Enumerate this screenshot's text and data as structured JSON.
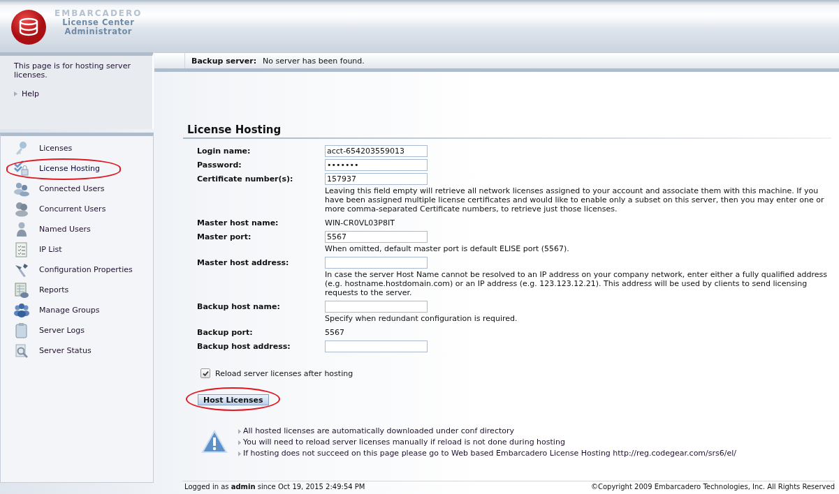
{
  "header": {
    "brand": "EMBARCADERO",
    "title_lines": [
      "License Center",
      "Administrator"
    ]
  },
  "sidebar": {
    "info": "This page is for hosting server licenses.",
    "help_link": "Help",
    "items": [
      {
        "label": "Licenses",
        "selected": false,
        "highlighted": false
      },
      {
        "label": "License Hosting",
        "selected": true,
        "highlighted": true
      },
      {
        "label": "Connected Users",
        "selected": false,
        "highlighted": false
      },
      {
        "label": "Concurrent Users",
        "selected": false,
        "highlighted": false
      },
      {
        "label": "Named Users",
        "selected": false,
        "highlighted": false
      },
      {
        "label": "IP List",
        "selected": false,
        "highlighted": false
      },
      {
        "label": "Configuration Properties",
        "selected": false,
        "highlighted": false
      },
      {
        "label": "Reports",
        "selected": false,
        "highlighted": false
      },
      {
        "label": "Manage Groups",
        "selected": false,
        "highlighted": false
      },
      {
        "label": "Server Logs",
        "selected": false,
        "highlighted": false
      },
      {
        "label": "Server Status",
        "selected": false,
        "highlighted": false
      }
    ]
  },
  "status_bar": {
    "label": "Backup server:",
    "value": "No server has been found."
  },
  "form": {
    "title": "License Hosting",
    "fields": [
      {
        "kind": "input",
        "label": "Login name:",
        "value": "acct-654203559013"
      },
      {
        "kind": "input",
        "label": "Password:",
        "value": "•••••••"
      },
      {
        "kind": "input",
        "label": "Certificate number(s):",
        "value": "157937",
        "hint": "Leaving this field empty will retrieve all network licenses assigned to your account and associate them with this machine. If you have been assigned multiple license certificates and would like to enable only a subset on this server, then you may enter one or more comma-separated Certificate numbers, to retrieve just those licenses."
      },
      {
        "kind": "text",
        "label": "Master host name:",
        "value": "WIN-CR0VL03P8IT"
      },
      {
        "kind": "input",
        "label": "Master port:",
        "value": "5567",
        "hint": "When omitted, default master port is default ELISE port (5567)."
      },
      {
        "kind": "input",
        "label": "Master host address:",
        "hint": "In case the server Host Name cannot be resolved to an IP address on your company network, enter either a fully qualified address (e.g. hostname.hostdomain.com) or an IP address (e.g. 123.123.12.21). This address will be used by clients to send licensing requests to the server."
      },
      {
        "kind": "input",
        "label": "Backup host name:",
        "hint": "Specify when redundant configuration is required."
      },
      {
        "kind": "text",
        "label": "Backup port:",
        "value": "5567"
      },
      {
        "kind": "input",
        "label": "Backup host address:"
      }
    ],
    "reload": {
      "label": "Reload server licenses after hosting",
      "checked": true
    },
    "button": {
      "label": "Host Licenses",
      "highlighted": true
    },
    "notes": [
      "All hosted licenses are automatically downloaded under conf directory",
      "You will need to reload server licenses manually if reload is not done during hosting",
      "If hosting does not succeed on this page please go to Web based Embarcadero License Hosting http://reg.codegear.com/srs6/el/"
    ]
  },
  "footer": {
    "login": "Logged in as **admin** since Oct 19, 2015 2:49:54 PM",
    "copyright": "©Copyright 2009 Embarcadero Technologies, Inc. All Rights Reserved"
  }
}
